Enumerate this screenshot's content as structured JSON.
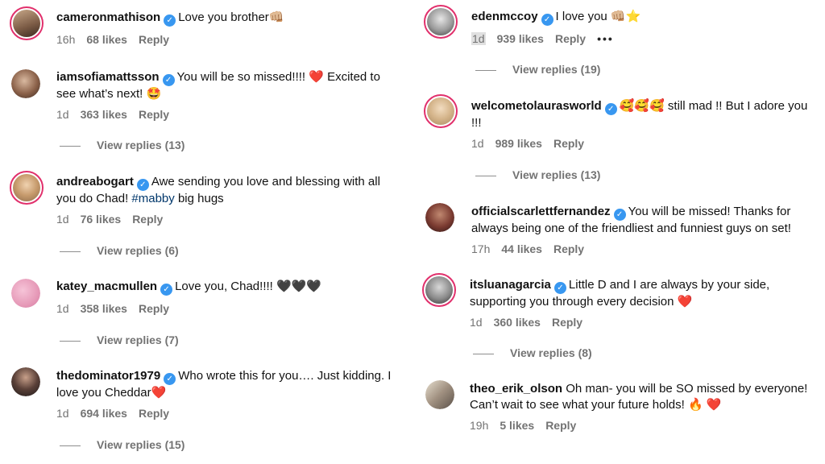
{
  "left": {
    "comments": [
      {
        "user": "cameronmathison",
        "text": "Love you brother👊🏼",
        "time": "16h",
        "likes": "68 likes",
        "reply": "Reply"
      },
      {
        "user": "iamsofiamattsson",
        "text": "You will be so missed!!!! ❤️ Excited to see what’s next! 🤩",
        "time": "1d",
        "likes": "363 likes",
        "reply": "Reply",
        "view_replies": "View replies (13)"
      },
      {
        "user": "andreabogart",
        "text_before": "Awe sending you love and blessing with all you do Chad! ",
        "hashtag": "#mabby",
        "text_after": " big hugs",
        "time": "1d",
        "likes": "76 likes",
        "reply": "Reply",
        "view_replies": "View replies (6)"
      },
      {
        "user": "katey_macmullen",
        "text": "Love you, Chad!!!! 🖤🖤🖤",
        "time": "1d",
        "likes": "358 likes",
        "reply": "Reply",
        "view_replies": "View replies (7)"
      },
      {
        "user": "thedominator1979",
        "text": "Who wrote this for you…. Just kidding. I love you Cheddar❤️",
        "time": "1d",
        "likes": "694 likes",
        "reply": "Reply",
        "view_replies": "View replies (15)"
      }
    ]
  },
  "right": {
    "comments": [
      {
        "user": "edenmccoy",
        "text": "I love you 👊🏼⭐",
        "time": "1d",
        "likes": "939 likes",
        "reply": "Reply",
        "more": "•••",
        "view_replies": "View replies (19)"
      },
      {
        "user": "welcometolaurasworld",
        "text": "🥰🥰🥰 still mad !! But I adore you !!!",
        "time": "1d",
        "likes": "989 likes",
        "reply": "Reply",
        "view_replies": "View replies (13)"
      },
      {
        "user": "officialscarlettfernandez",
        "text": "You will be missed! Thanks for always being one of the friendliest and funniest guys on set!",
        "time": "17h",
        "likes": "44 likes",
        "reply": "Reply"
      },
      {
        "user": "itsluanagarcia",
        "text": "Little D and I are always by your side, supporting you through every decision ❤️",
        "time": "1d",
        "likes": "360 likes",
        "reply": "Reply",
        "view_replies": "View replies (8)"
      },
      {
        "user": "theo_erik_olson",
        "text": "Oh man- you will be SO missed by everyone! Can’t wait to see what your future holds! 🔥 ❤️",
        "time": "19h",
        "likes": "5 likes",
        "reply": "Reply"
      }
    ]
  },
  "colors": {
    "verified": "#3897f0",
    "story_ring": "#e1306c",
    "meta": "#737373",
    "hashtag": "#00376b"
  }
}
